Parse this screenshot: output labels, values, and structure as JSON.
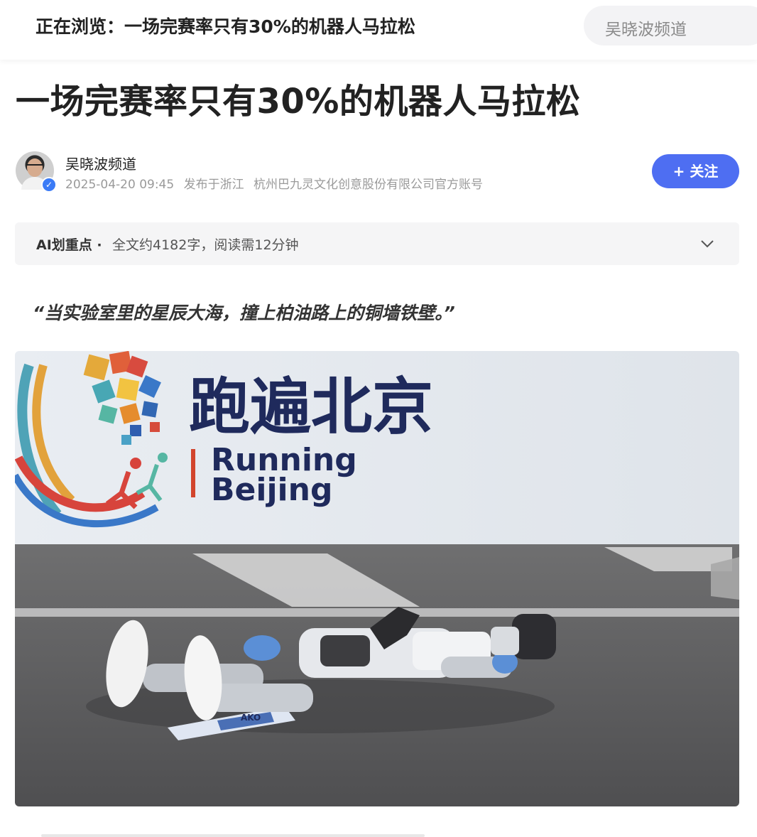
{
  "header": {
    "browsing_title": "正在浏览：一场完赛率只有30%的机器人马拉松",
    "search_placeholder": "吴晓波频道"
  },
  "article": {
    "title": "一场完赛率只有30%的机器人马拉松",
    "author": {
      "name": "吴晓波频道",
      "datetime": "2025-04-20 09:45",
      "location": "发布于浙江",
      "org": "杭州巴九灵文化创意股份有限公司官方账号",
      "follow_label": "+ 关注"
    },
    "ai_summary": {
      "label": "AI划重点",
      "separator": "·",
      "info": "全文约4182字，阅读需12分钟"
    },
    "quote": "“当实验室里的星辰大海，撞上柏油路上的铜墙铁壁。”",
    "photo": {
      "sign_chinese": "跑遍北京",
      "sign_english_1": "Running",
      "sign_english_2": "Beijing",
      "bib_text": "AKO"
    }
  },
  "colors": {
    "accent": "#4e6ef2",
    "verified": "#3b7bf6",
    "sign_navy": "#1f2a5c",
    "sign_red": "#d2452d"
  }
}
